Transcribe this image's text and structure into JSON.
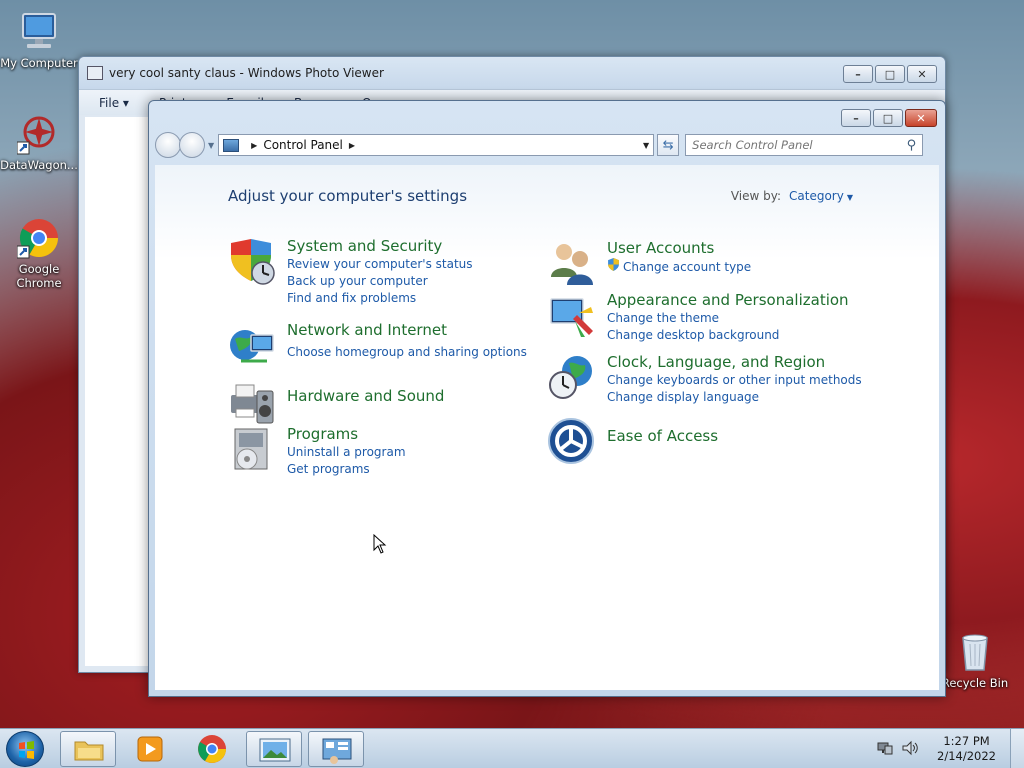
{
  "desktop": {
    "icons": [
      {
        "label": "My Computer"
      },
      {
        "label": "DataWagon..."
      },
      {
        "label": "Google Chrome"
      },
      {
        "label": "Recycle Bin"
      }
    ]
  },
  "photo_viewer": {
    "title": "very cool santy claus - Windows Photo Viewer",
    "menu": [
      {
        "label": "File"
      },
      {
        "label": "Print"
      },
      {
        "label": "E-mail"
      },
      {
        "label": "Burn"
      },
      {
        "label": "Open"
      }
    ]
  },
  "control_panel": {
    "breadcrumb": "Control Panel",
    "search_placeholder": "Search Control Panel",
    "heading": "Adjust your computer's settings",
    "view_by_label": "View by:",
    "view_by_value": "Category",
    "left_categories": [
      {
        "title": "System and Security",
        "links": [
          "Review your computer's status",
          "Back up your computer",
          "Find and fix problems"
        ]
      },
      {
        "title": "Network and Internet",
        "links": [
          "Choose homegroup and sharing options"
        ]
      },
      {
        "title": "Hardware and Sound",
        "links": []
      },
      {
        "title": "Programs",
        "links": [
          "Uninstall a program",
          "Get programs"
        ]
      }
    ],
    "right_categories": [
      {
        "title": "User Accounts",
        "links": [
          "Change account type"
        ]
      },
      {
        "title": "Appearance and Personalization",
        "links": [
          "Change the theme",
          "Change desktop background"
        ]
      },
      {
        "title": "Clock, Language, and Region",
        "links": [
          "Change keyboards or other input methods",
          "Change display language"
        ]
      },
      {
        "title": "Ease of Access",
        "links": []
      }
    ]
  },
  "taskbar": {
    "time": "1:27 PM",
    "date": "2/14/2022"
  }
}
